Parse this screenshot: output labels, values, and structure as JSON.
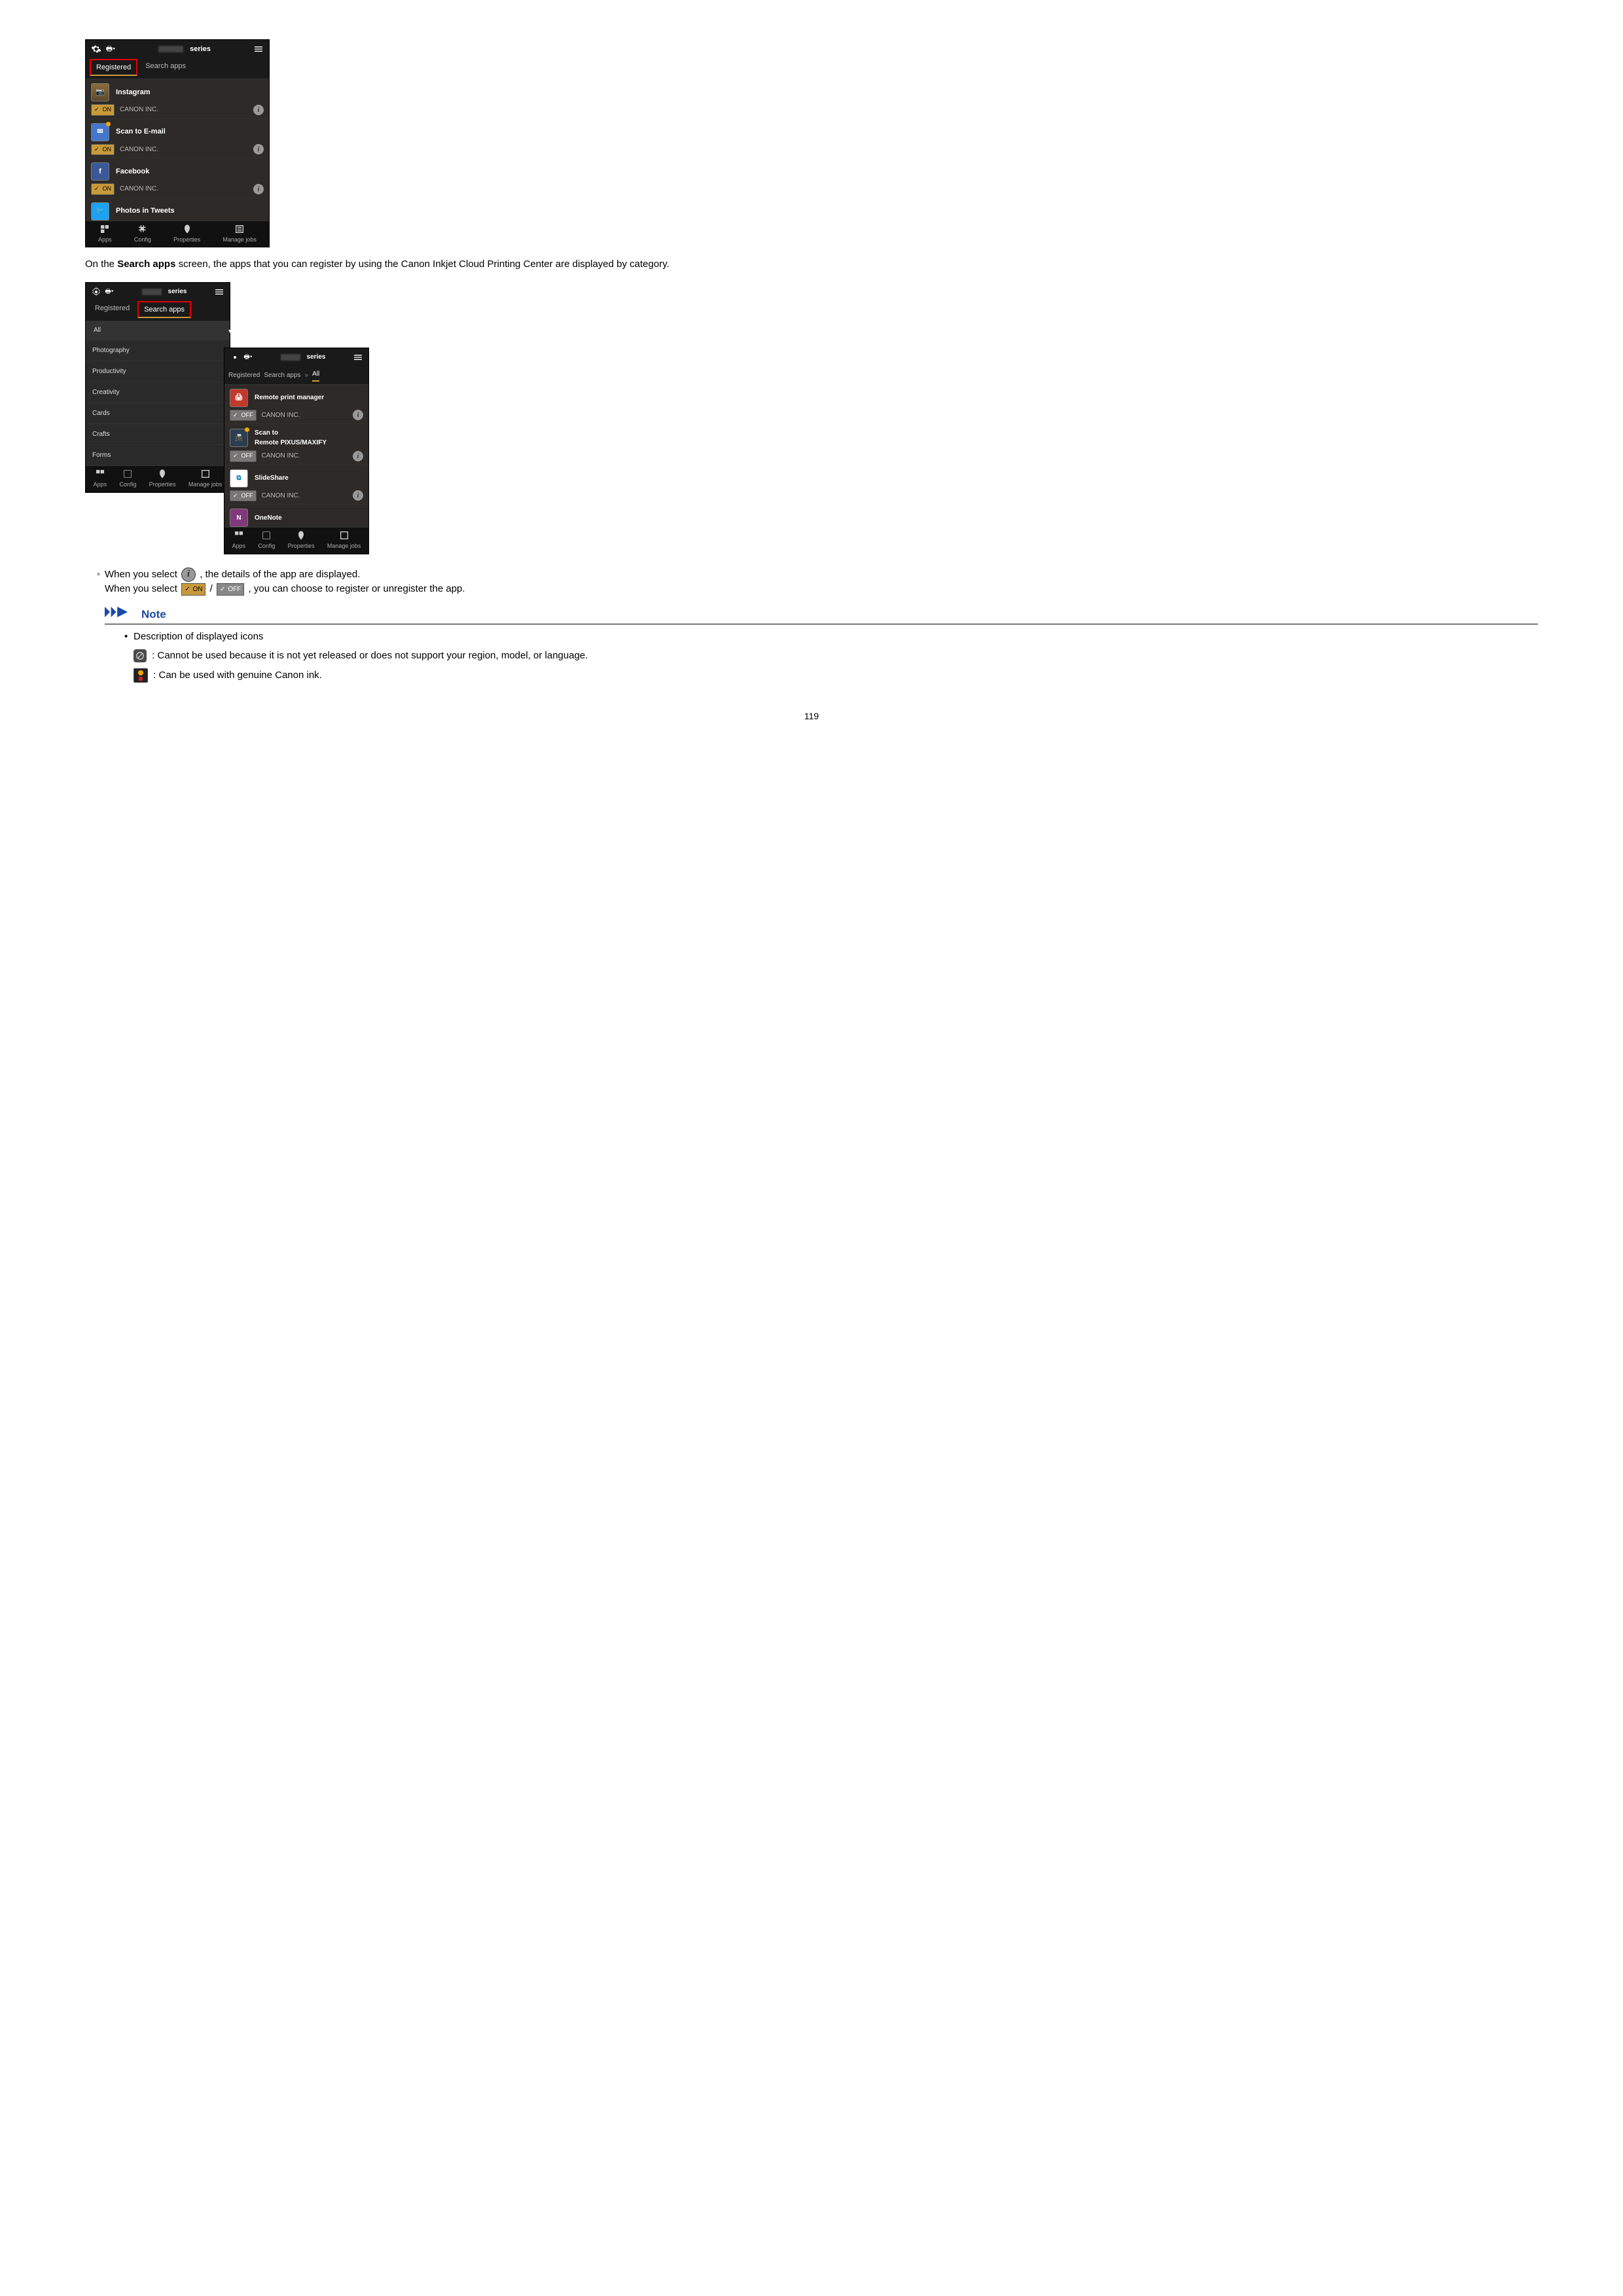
{
  "page_number": "119",
  "para1_a": "On the ",
  "para1_b": "Search apps",
  "para1_c": " screen, the apps that you can register by using the Canon Inkjet Cloud Printing Center are displayed by category.",
  "bullets": {
    "b1a": "When you select ",
    "b1b": ", the details of the app are displayed.",
    "b2a": "When you select ",
    "b2b": " / ",
    "b2c": ", you can choose to register or unregister the app."
  },
  "note": {
    "title": "Note",
    "line1": "Description of displayed icons",
    "line2": " : Cannot be used because it is not yet released or does not support your region, model, or language.",
    "line3": " : Can be used with genuine Canon ink."
  },
  "phone": {
    "series": "series",
    "tab_registered": "Registered",
    "tab_search": "Search apps",
    "all": "All",
    "vendor": "CANON INC.",
    "on": "ON",
    "off": "OFF",
    "nav": {
      "apps": "Apps",
      "config": "Config",
      "properties": "Properties",
      "manage": "Manage jobs"
    },
    "apps1": [
      {
        "name": "Instagram"
      },
      {
        "name": "Scan to E-mail"
      },
      {
        "name": "Facebook"
      },
      {
        "name": "Photos in Tweets"
      }
    ],
    "categories": [
      "Photography",
      "Productivity",
      "Creativity",
      "Cards",
      "Crafts",
      "Forms"
    ],
    "apps3": [
      {
        "name": "Remote print manager"
      },
      {
        "name": "Scan to\nRemote PIXUS/MAXIFY"
      },
      {
        "name": "SlideShare"
      },
      {
        "name": "OneNote"
      }
    ]
  }
}
